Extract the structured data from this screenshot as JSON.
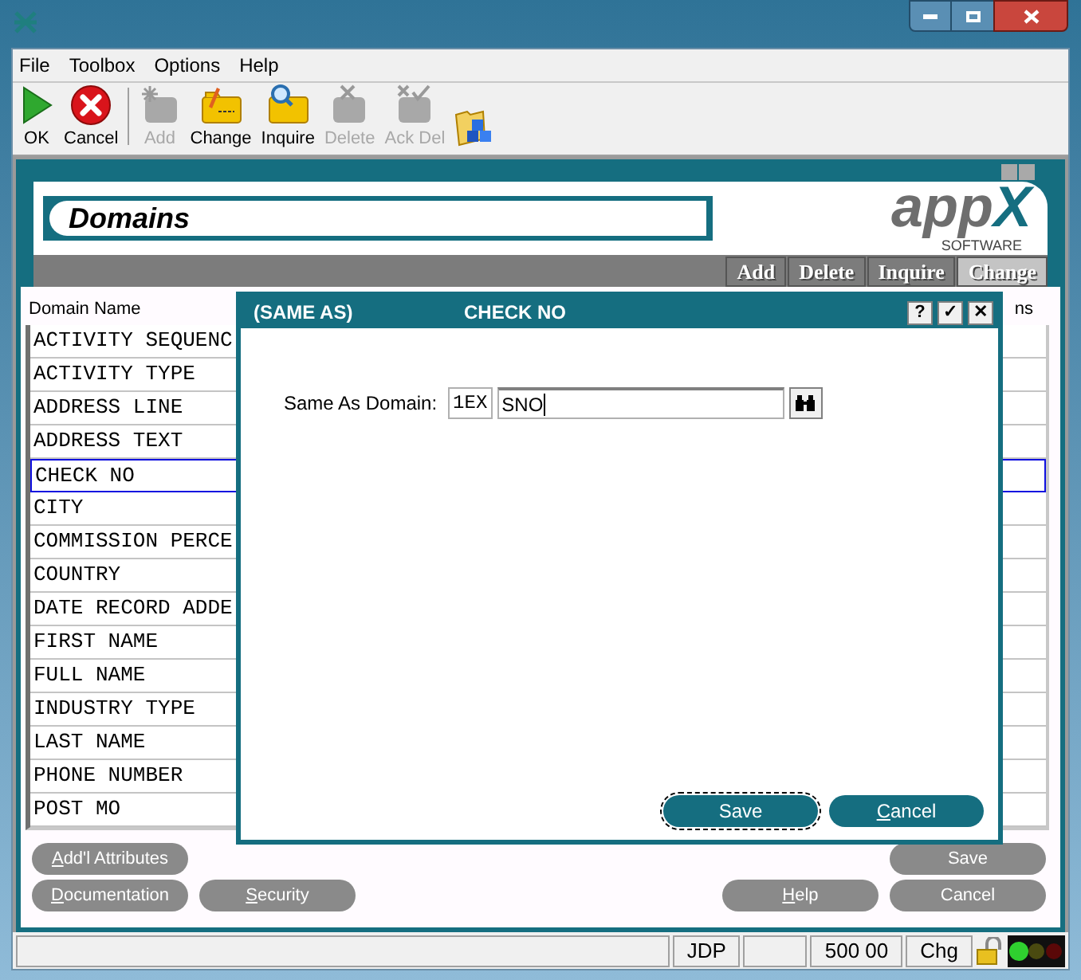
{
  "menu": [
    "File",
    "Toolbox",
    "Options",
    "Help"
  ],
  "toolbar": [
    {
      "kind": "ok",
      "label": "OK",
      "disabled": false
    },
    {
      "kind": "cancel",
      "label": "Cancel",
      "disabled": false
    },
    {
      "kind": "separator"
    },
    {
      "kind": "add",
      "label": "Add",
      "disabled": true
    },
    {
      "kind": "change",
      "label": "Change",
      "disabled": false
    },
    {
      "kind": "inquire",
      "label": "Inquire",
      "disabled": false
    },
    {
      "kind": "delete",
      "label": "Delete",
      "disabled": true
    },
    {
      "kind": "ackdel",
      "label": "Ack Del",
      "disabled": true
    },
    {
      "kind": "folder"
    }
  ],
  "screen": {
    "title": "Domains",
    "logo": {
      "text": "app",
      "mark": "X",
      "tagline": "SOFTWARE"
    },
    "actions": [
      {
        "label": "Add",
        "selected": false
      },
      {
        "label": "Delete",
        "selected": false
      },
      {
        "label": "Inquire",
        "selected": false
      },
      {
        "label": "Change",
        "selected": true
      }
    ]
  },
  "list": {
    "columns": [
      "Domain Name",
      "ns"
    ],
    "rows": [
      {
        "name": "ACTIVITY SEQUENC",
        "selected": false
      },
      {
        "name": "ACTIVITY TYPE",
        "selected": false
      },
      {
        "name": "ADDRESS LINE",
        "selected": false
      },
      {
        "name": "ADDRESS TEXT",
        "selected": false
      },
      {
        "name": "CHECK NO",
        "selected": true
      },
      {
        "name": "CITY",
        "selected": false
      },
      {
        "name": "COMMISSION PERCE",
        "selected": false
      },
      {
        "name": "COUNTRY",
        "selected": false
      },
      {
        "name": "DATE RECORD ADDE",
        "selected": false
      },
      {
        "name": "FIRST NAME",
        "selected": false
      },
      {
        "name": "FULL NAME",
        "selected": false
      },
      {
        "name": "INDUSTRY TYPE",
        "selected": false
      },
      {
        "name": "LAST NAME",
        "selected": false
      },
      {
        "name": "PHONE NUMBER",
        "selected": false
      },
      {
        "name": "POST MO",
        "selected": false
      }
    ]
  },
  "buttons_left": [
    [
      {
        "label": "Add'l Attributes",
        "underline_first": true
      }
    ],
    [
      {
        "label": "Documentation",
        "underline_first": true
      },
      {
        "label": "Security",
        "underline_first": true
      }
    ]
  ],
  "buttons_right": [
    [
      {
        "label": "Save",
        "underline_first": false
      }
    ],
    [
      {
        "label": "Help",
        "underline_first": true
      },
      {
        "label": "Cancel",
        "underline_first": false
      }
    ]
  ],
  "dialog": {
    "tag": "(SAME AS)",
    "title": "CHECK NO",
    "title_buttons": [
      "?",
      "✓",
      "✕"
    ],
    "label": "Same As Domain:",
    "prefix": "1EX",
    "value": "SNO",
    "buttons": [
      {
        "label": "Save",
        "focused": true,
        "underline_first": false
      },
      {
        "label": "Cancel",
        "focused": false,
        "underline_first": true
      }
    ]
  },
  "status_bar": [
    {
      "kind": "blank"
    },
    {
      "kind": "text",
      "text": "JDP"
    },
    {
      "kind": "blank"
    },
    {
      "kind": "text",
      "text": "500 00"
    },
    {
      "kind": "text",
      "text": "Chg"
    },
    {
      "kind": "lock"
    },
    {
      "kind": "lights"
    }
  ]
}
